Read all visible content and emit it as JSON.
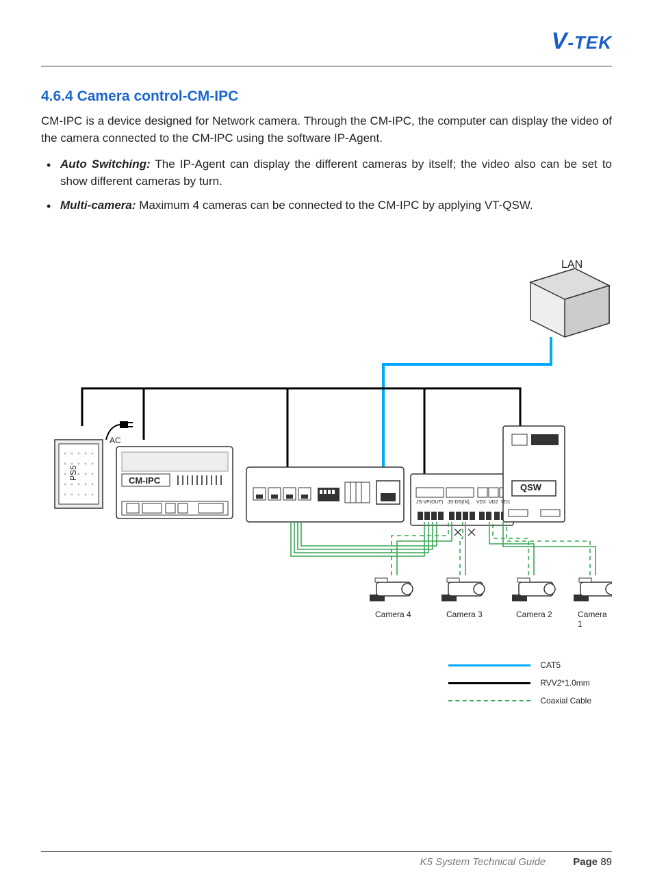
{
  "brand": "V-TEK",
  "section_number": "4.6.4",
  "section_title": "Camera control-CM-IPC",
  "intro": "CM-IPC is a device designed for Network camera. Through the CM-IPC, the computer can display the video of the camera connected to the CM-IPC using the software IP-Agent.",
  "bullets": [
    {
      "term": "Auto Switching:",
      "text": " The IP-Agent can display the different cameras by itself; the video also can be set to show different cameras by turn."
    },
    {
      "term": "Multi-camera:",
      "text": " Maximum 4 cameras can be connected to the CM-IPC by applying  VT-QSW."
    }
  ],
  "diagram": {
    "labels": {
      "lan": "LAN",
      "ac": "AC",
      "ps5": "PS5",
      "cm_ipc": "CM-IPC",
      "qsw": "QSW",
      "cam4": "Camera 4",
      "cam3": "Camera 3",
      "cam2": "Camera 2",
      "cam1": "Camera 1",
      "js_vp_out": "JS-VP(OUT)",
      "js_ds_in": "JS-DS(IN)",
      "vd3": "VD3",
      "vd2": "VD2",
      "vd1": "VD1"
    },
    "legend": {
      "cat5": "CAT5",
      "rvv": "RVV2*1.0mm",
      "coax": "Coaxial Cable"
    }
  },
  "footer": {
    "guide": "K5 System Technical Guide",
    "page_label": "Page",
    "page_num": "89"
  }
}
